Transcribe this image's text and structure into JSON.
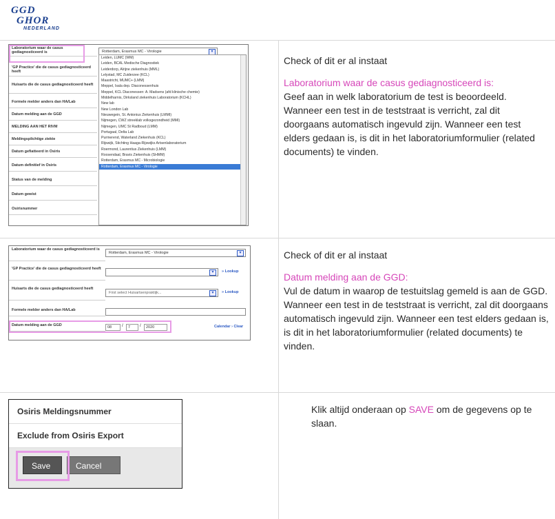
{
  "logo": {
    "line1": "GGD",
    "line2": "GHOR",
    "line3": "NEDERLAND"
  },
  "section1": {
    "fields": [
      "Laboratorium waar de casus gediagnosticeerd is",
      "'GP Practice' die de casus gediagnosticeerd heeft",
      "Huisarts die de casus gediagnosticeerd heeft",
      "Formele melder anders dan HA/Lab",
      "Datum melding aan de GGD",
      "MELDING AAN HET RIVM",
      "Meldingsplichtige ziekte",
      "Datum gefiatteerd in Osiris",
      "Datum definitief in Osiris",
      "Status van de melding",
      "Datum gewist",
      "Osirisnummer"
    ],
    "selected_value": "Rotterdam, Erasmus MC - Virologie",
    "dropdown_items": [
      "Leiden, LUMC (WM)",
      "Leiden, BCAL Medische Diagnostiek",
      "Leiderdorp, Alrijne ziekenhuis (MML)",
      "Lelystad, MC Zuiderzee (KCL)",
      "Maastricht, MUMC+ (LMM)",
      "Meppel, Isala dep. Diaconessenhuis",
      "Meppel, KCL Diaconessen: A. Madsens (afd klinische chemie)",
      "Middelharnis, Dirksland ziekenhuis Laboratorium (KCHL)",
      "New lab",
      "New London Lab",
      "Nieuwegein, St. Antonius Ziekenhuis (LMMI)",
      "Nijmegen, CWZ streeklab volksgezondheid (MMI)",
      "Nijmegen, UMC St Radboud (LMM)",
      "Portugaal, Delta Lab",
      "Purmerend, Waterland Ziekenhuis (KCL)",
      "Rijswijk, Stichting Haaga-Rijswijks Artsenlaboratorium",
      "Roermond, Laurentius Ziekenhuis (LMM)",
      "Roosendaal, Bravis Ziekenhuis (SHMM)",
      "Rotterdam, Erasmus MC - Microbiologie",
      "Rotterdam, Erasmus MC - Virologie"
    ],
    "heading": "Check of dit er al instaat",
    "subheading": "Laboratorium waar de casus gediagnosticeerd is:",
    "body": "Geef aan in welk laboratorium de test is beoordeeld. Wanneer een test in de teststraat is verricht, zal dit doorgaans automatisch ingevuld zijn. Wanneer een test elders gedaan is, is dit in het laboratoriumformulier (related documents) te vinden."
  },
  "section2": {
    "fields": [
      "Laboratorium waar de casus gediagnosticeerd is",
      "'GP Practice' die de casus gediagnosticeerd heeft",
      "Huisarts die de casus gediagnosticeerd heeft",
      "Formele melder anders dan HA/Lab",
      "Datum melding aan de GGD"
    ],
    "lab_value": "Rotterdam, Erasmus MC - Virologie",
    "huisarts_placeholder": "First select Huisartsenpraktijk...",
    "lookup_label": "» Lookup",
    "date_day": "08",
    "date_month": "7",
    "date_year": "2020",
    "calendar_label": "Calendar",
    "clear_label": "Clear",
    "heading": "Check of dit er al instaat",
    "subheading": "Datum melding aan de GGD:",
    "body": "Vul de datum in waarop de testuitslag gemeld is aan de GGD. Wanneer een test in de teststraat is verricht, zal dit doorgaans automatisch ingevuld zijn. Wanneer een test elders gedaan is, is dit in het laboratoriumformulier (related documents) te vinden."
  },
  "section3": {
    "item1": "Osiris Meldingsnummer",
    "item2": "Exclude from Osiris Export",
    "save": "Save",
    "cancel": "Cancel",
    "text_before": "Klik altijd onderaan op ",
    "text_save": "SAVE",
    "text_after": " om de gegevens op te slaan."
  }
}
